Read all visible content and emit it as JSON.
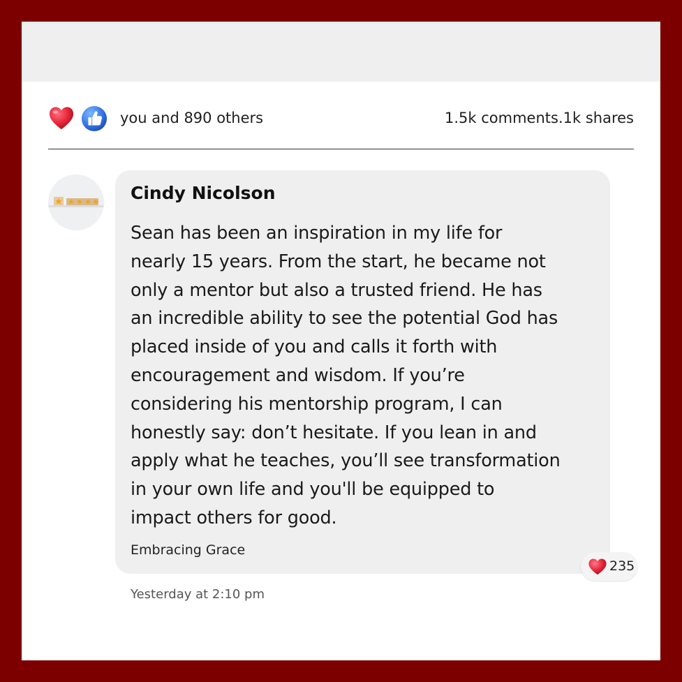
{
  "reactions": {
    "icons": [
      "heart-icon",
      "like-icon"
    ],
    "summary": "you and 890 others",
    "stats": "1.5k comments.1k shares"
  },
  "comment": {
    "author": "Cindy Nicolson",
    "avatar_icon": "rating-stars-icon",
    "body_lines": [
      "Sean has been an inspiration in my life for",
      "nearly 15 years. From the start, he became not",
      "only a mentor but also a trusted friend. He has",
      "an incredible ability to see the potential God has",
      "placed inside of you and calls it forth with",
      "encouragement and wisdom. If you’re",
      "considering his mentorship program, I can",
      "honestly say: don’t hesitate. If you lean in and",
      "apply what he teaches, you’ll see transformation",
      "in your own life and you'll be equipped to",
      "impact others for good."
    ],
    "affiliation": "Embracing Grace",
    "like_count": "235",
    "timestamp": "Yesterday at 2:10 pm"
  },
  "colors": {
    "frame": "#7d0000",
    "heart": "#e8283c",
    "like": "#3b82f6"
  }
}
